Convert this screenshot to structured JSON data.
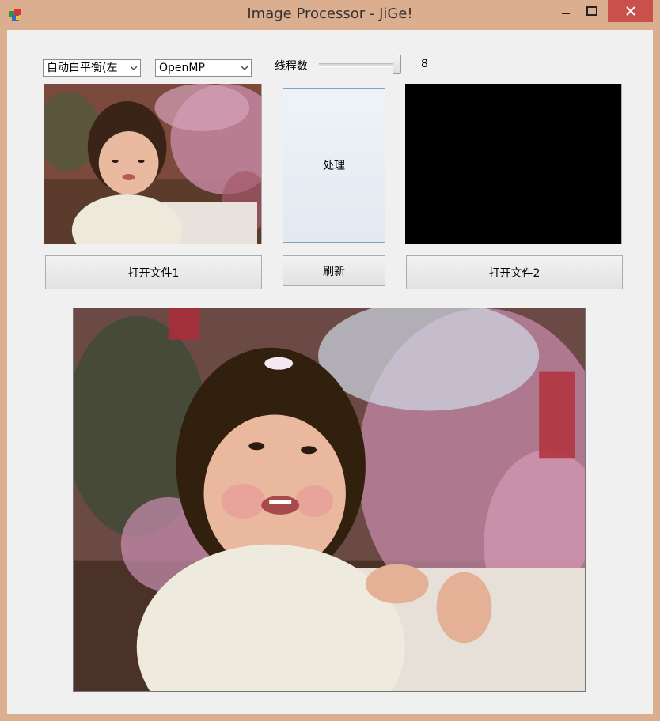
{
  "window": {
    "title": "Image Processor - JiGe!",
    "controls": {
      "minimize": "minimize-icon",
      "maximize": "maximize-icon",
      "close": "close-icon"
    }
  },
  "toolbar": {
    "algorithm_select": {
      "value": "自动白平衡(左"
    },
    "backend_select": {
      "value": "OpenMP"
    },
    "threads_label": "线程数",
    "threads_value": "8"
  },
  "buttons": {
    "process": "处理",
    "refresh": "刷新",
    "open_file_1": "打开文件1",
    "open_file_2": "打开文件2"
  },
  "slider": {
    "threads_level": 1.0
  },
  "colors": {
    "frame": "#dcae90",
    "close": "#c9504b",
    "client": "#f0f0f0",
    "output_pane": "#000000"
  }
}
